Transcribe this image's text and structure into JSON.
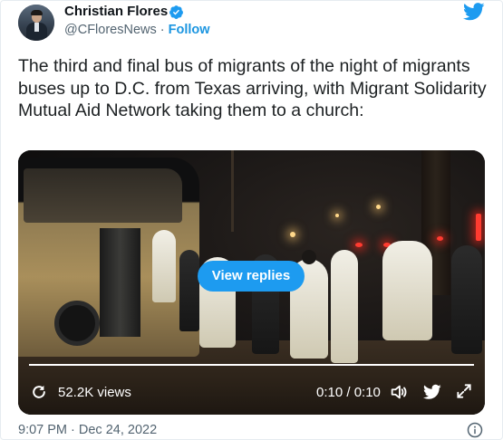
{
  "author": {
    "name": "Christian Flores",
    "handle": "@CFloresNews",
    "separator": " · ",
    "follow_label": "Follow",
    "verified_icon": "verified-badge-icon",
    "avatar": "avatar-photo"
  },
  "brand": {
    "icon": "twitter-bird-icon",
    "color": "#1d9bf0"
  },
  "tweet": {
    "text": "The third and final bus of migrants of the night of migrants buses up to D.C. from Texas arriving, with Migrant Solidarity Mutual Aid Network taking them to a church:"
  },
  "media": {
    "kind": "video",
    "view_replies_label": "View replies",
    "views_label": "52.2K views",
    "time_label": "0:10 / 0:10",
    "progress": 1.0,
    "icons": [
      "replay-icon",
      "volume-icon",
      "twitter-bird-icon",
      "expand-icon"
    ]
  },
  "footer": {
    "timestamp": "9:07 PM · Dec 24, 2022",
    "info_icon": "info-icon"
  },
  "colors": {
    "text_primary": "#0f1419",
    "text_secondary": "#536471",
    "link": "#1b95e0",
    "accent": "#1d9bf0"
  }
}
